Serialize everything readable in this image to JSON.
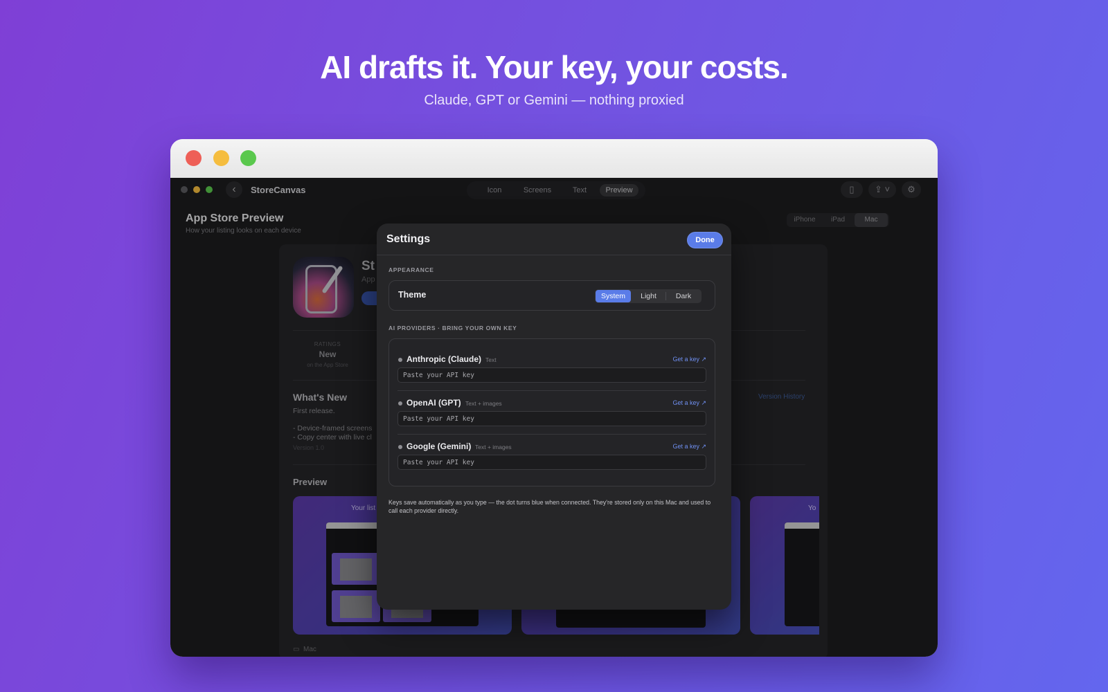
{
  "hero": {
    "headline": "AI drafts it. Your key, your costs.",
    "subheadline": "Claude, GPT or Gemini — nothing proxied"
  },
  "app": {
    "title": "StoreCanvas",
    "nav_tabs": [
      {
        "label": "Icon",
        "active": false
      },
      {
        "label": "Screens",
        "active": false
      },
      {
        "label": "Text",
        "active": false
      },
      {
        "label": "Preview",
        "active": true
      }
    ],
    "toolbar_icons": [
      "back-chevron-icon",
      "sidebar-toggle-icon",
      "share-icon",
      "gear-icon"
    ]
  },
  "page": {
    "title": "App Store Preview",
    "subtitle": "How your listing looks on each device",
    "device_tabs": [
      {
        "label": "iPhone",
        "active": false
      },
      {
        "label": "iPad",
        "active": false
      },
      {
        "label": "Mac",
        "active": true
      }
    ]
  },
  "listing": {
    "name_fragment": "St",
    "subtitle_fragment": "App",
    "ratings_label": "RATINGS",
    "ratings_value": "New",
    "ratings_sub": "on the App Store",
    "whats_new_title": "What's New",
    "whats_new_lines": [
      "First release.",
      "- Device-framed screens",
      "- Copy center with live cl"
    ],
    "version": "Version 1.0",
    "version_history": "Version History",
    "preview_heading": "Preview",
    "shot_caption_1": "Your list",
    "shot_caption_3": "Yo",
    "device_caption": "Mac"
  },
  "settings": {
    "title": "Settings",
    "done_label": "Done",
    "appearance_label": "APPEARANCE",
    "theme_label": "Theme",
    "theme_options": [
      {
        "label": "System",
        "selected": true
      },
      {
        "label": "Light",
        "selected": false
      },
      {
        "label": "Dark",
        "selected": false
      }
    ],
    "providers_label": "AI PROVIDERS · BRING YOUR OWN KEY",
    "providers": [
      {
        "name": "Anthropic (Claude)",
        "capability": "Text",
        "get_key": "Get a key ↗",
        "value": "",
        "placeholder": "Paste your API key",
        "connected": false
      },
      {
        "name": "OpenAI (GPT)",
        "capability": "Text + images",
        "get_key": "Get a key ↗",
        "value": "",
        "placeholder": "Paste your API key",
        "connected": false
      },
      {
        "name": "Google (Gemini)",
        "capability": "Text + images",
        "get_key": "Get a key ↗",
        "value": "",
        "placeholder": "Paste your API key",
        "connected": false
      }
    ],
    "footnote": "Keys save automatically as you type — the dot turns blue when connected. They're stored only on this Mac and used to call each provider directly."
  },
  "colors": {
    "accent": "#5a7ce8",
    "link": "#6f8ff0",
    "dot_disconnected": "#8e8e93",
    "window_red": "#ee5f57",
    "window_yellow": "#f5bd3f",
    "window_green": "#5ac84d"
  }
}
